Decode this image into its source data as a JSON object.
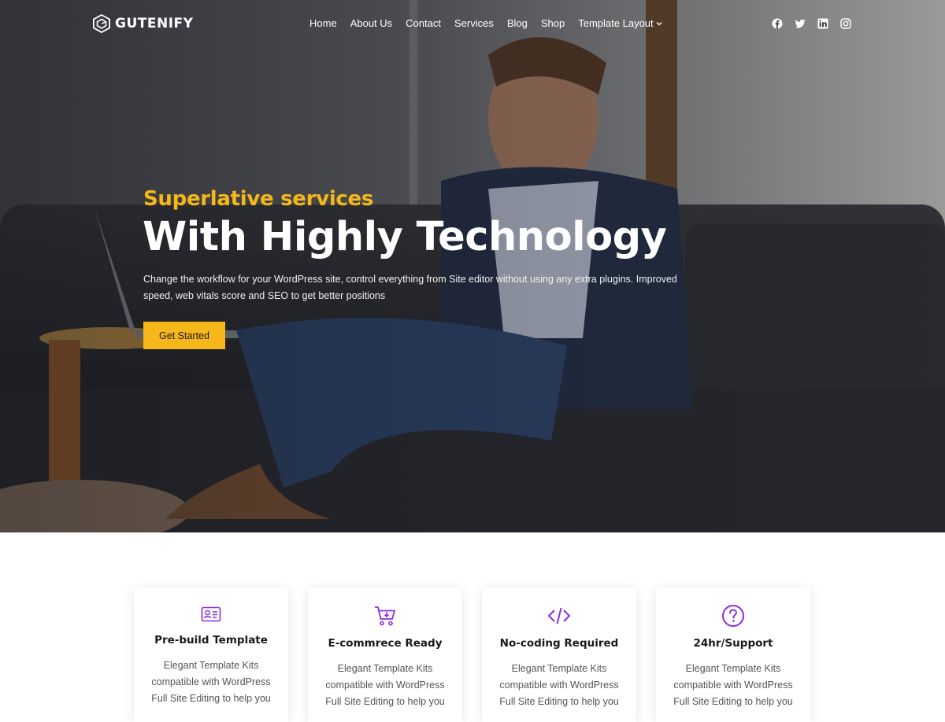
{
  "brand": {
    "name": "GUTENIFY"
  },
  "nav": {
    "items": [
      {
        "label": "Home"
      },
      {
        "label": "About Us"
      },
      {
        "label": "Contact"
      },
      {
        "label": "Services"
      },
      {
        "label": "Blog"
      },
      {
        "label": "Shop"
      },
      {
        "label": "Template Layout"
      }
    ],
    "socials": [
      "facebook-icon",
      "twitter-icon",
      "linkedin-icon",
      "instagram-icon"
    ]
  },
  "hero": {
    "subtitle": "Superlative services",
    "title": "With Highly Technology",
    "description": "Change the workflow for your WordPress site, control everything from Site editor without using any extra plugins. Improved speed, web vitals score and SEO to get better positions",
    "cta_label": "Get Started"
  },
  "colors": {
    "accent": "#f6b71a",
    "icon": "#8a2be2"
  },
  "features": [
    {
      "icon": "id-card-icon",
      "title": "Pre-build Template",
      "text": "Elegant Template Kits compatible with WordPress Full Site Editing to help you"
    },
    {
      "icon": "cart-icon",
      "title": "E-commrece Ready",
      "text": "Elegant Template Kits compatible with WordPress Full Site Editing to help you"
    },
    {
      "icon": "code-icon",
      "title": "No-coding Required",
      "text": "Elegant Template Kits compatible with WordPress Full Site Editing to help you"
    },
    {
      "icon": "question-icon",
      "title": "24hr/Support",
      "text": "Elegant Template Kits compatible with WordPress Full Site Editing to help you"
    }
  ]
}
